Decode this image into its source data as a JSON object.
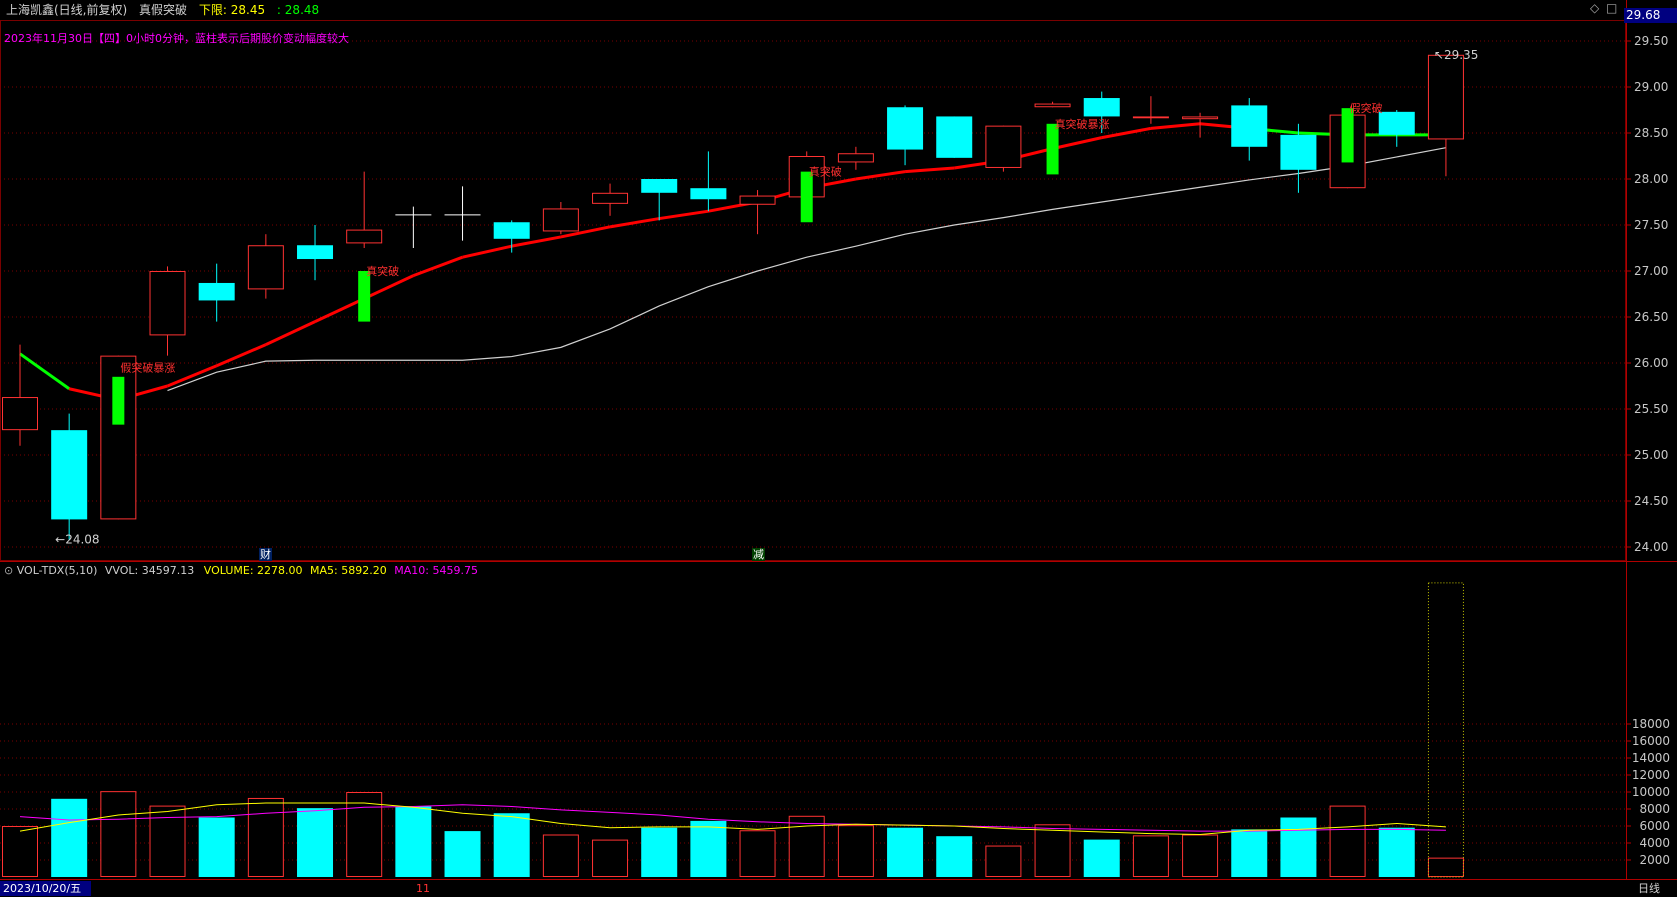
{
  "header": {
    "stock_name": "上海凯鑫(日线,前复权)",
    "indicator_name": "真假突破",
    "lower_limit_label": "下限:",
    "lower_limit_value": "28.45",
    "sep_label": ":",
    "sep_value": "28.48"
  },
  "info_line": "2023年11月30日【四】0小时0分钟，蓝柱表示后期股价变动幅度较大",
  "top_right": {
    "price_box": "29.68",
    "diamond": "◇",
    "square": "□"
  },
  "volume_header": {
    "name": "VOL-TDX(5,10)",
    "vvol_label": "VVOL: 34597.13",
    "volume_label": "VOLUME: 2278.00",
    "ma5_label": "MA5: 5892.20",
    "ma10_label": "MA10: 5459.75"
  },
  "bottom": {
    "date_box": "2023/10/20/五",
    "month_mark": "11",
    "period": "日线"
  },
  "event_marks": {
    "cai": "财",
    "jian": "减"
  },
  "colors": {
    "up": "#ff3232",
    "down": "#00ffff",
    "flat": "#ffffff",
    "ma_red": "#ff0000",
    "ma_green": "#00ff00",
    "ma_white": "#d0d0d0",
    "vol_ma5": "#ffff00",
    "vol_ma10": "#ff00ff",
    "grid": "#7a0000",
    "signal_text": "#ff3030",
    "header_yellow": "#ffff00",
    "header_green": "#00ff00",
    "header_magenta": "#ff00ff"
  },
  "chart_data": {
    "type": "candlestick",
    "price_axis": {
      "min": 24.0,
      "max": 29.5,
      "ticks": [
        24.0,
        24.5,
        25.0,
        25.5,
        26.0,
        26.5,
        27.0,
        27.5,
        28.0,
        28.5,
        29.0,
        29.5
      ]
    },
    "volume_axis": {
      "min": 0,
      "max": 34597.13,
      "ticks": [
        2000,
        4000,
        6000,
        8000,
        10000,
        12000,
        14000,
        16000,
        18000
      ]
    },
    "candles": [
      {
        "o": 25.27,
        "c": 25.63,
        "h": 26.2,
        "l": 25.1,
        "v": 6000
      },
      {
        "o": 25.27,
        "c": 24.3,
        "h": 25.45,
        "l": 24.08,
        "v": 9200
      },
      {
        "o": 24.3,
        "c": 26.08,
        "h": 26.08,
        "l": 24.3,
        "v": 10100
      },
      {
        "o": 26.3,
        "c": 27.0,
        "h": 27.05,
        "l": 26.08,
        "v": 8400
      },
      {
        "o": 26.87,
        "c": 26.68,
        "h": 27.08,
        "l": 26.45,
        "v": 7000
      },
      {
        "o": 26.8,
        "c": 27.28,
        "h": 27.4,
        "l": 26.7,
        "v": 9300
      },
      {
        "o": 27.28,
        "c": 27.13,
        "h": 27.5,
        "l": 26.9,
        "v": 8100
      },
      {
        "o": 27.3,
        "c": 27.45,
        "h": 28.08,
        "l": 27.25,
        "v": 10000
      },
      {
        "o": 27.61,
        "c": 27.61,
        "h": 27.7,
        "l": 27.25,
        "v": 8300
      },
      {
        "o": 27.61,
        "c": 27.61,
        "h": 27.92,
        "l": 27.33,
        "v": 5400
      },
      {
        "o": 27.53,
        "c": 27.35,
        "h": 27.55,
        "l": 27.2,
        "v": 7500
      },
      {
        "o": 27.43,
        "c": 27.68,
        "h": 27.75,
        "l": 27.4,
        "v": 5000
      },
      {
        "o": 27.73,
        "c": 27.85,
        "h": 27.95,
        "l": 27.6,
        "v": 4400
      },
      {
        "o": 28.0,
        "c": 27.85,
        "h": 28.0,
        "l": 27.55,
        "v": 5800
      },
      {
        "o": 27.9,
        "c": 27.78,
        "h": 28.3,
        "l": 27.65,
        "v": 6600
      },
      {
        "o": 27.72,
        "c": 27.82,
        "h": 27.88,
        "l": 27.4,
        "v": 5500
      },
      {
        "o": 27.8,
        "c": 28.25,
        "h": 28.3,
        "l": 27.7,
        "v": 7200
      },
      {
        "o": 28.18,
        "c": 28.28,
        "h": 28.35,
        "l": 28.1,
        "v": 6100
      },
      {
        "o": 28.78,
        "c": 28.32,
        "h": 28.8,
        "l": 28.15,
        "v": 5800
      },
      {
        "o": 28.68,
        "c": 28.23,
        "h": 28.68,
        "l": 28.23,
        "v": 4800
      },
      {
        "o": 28.12,
        "c": 28.58,
        "h": 28.58,
        "l": 28.08,
        "v": 3700
      },
      {
        "o": 28.78,
        "c": 28.82,
        "h": 28.84,
        "l": 28.78,
        "v": 6200
      },
      {
        "o": 28.88,
        "c": 28.68,
        "h": 28.95,
        "l": 28.5,
        "v": 4400
      },
      {
        "o": 28.66,
        "c": 28.68,
        "h": 28.9,
        "l": 28.6,
        "v": 4900
      },
      {
        "o": 28.65,
        "c": 28.68,
        "h": 28.72,
        "l": 28.45,
        "v": 5000
      },
      {
        "o": 28.8,
        "c": 28.35,
        "h": 28.88,
        "l": 28.2,
        "v": 5600
      },
      {
        "o": 28.48,
        "c": 28.1,
        "h": 28.6,
        "l": 27.85,
        "v": 7000
      },
      {
        "o": 27.9,
        "c": 28.7,
        "h": 28.75,
        "l": 27.9,
        "v": 8400
      },
      {
        "o": 28.73,
        "c": 28.48,
        "h": 28.75,
        "l": 28.35,
        "v": 5800
      },
      {
        "o": 28.43,
        "c": 29.35,
        "h": 29.35,
        "l": 28.03,
        "v": 2278
      }
    ],
    "future_volume_box": 34597.13,
    "ma_white": [
      null,
      null,
      null,
      25.7,
      25.9,
      26.02,
      26.03,
      26.03,
      26.03,
      26.03,
      26.07,
      26.17,
      26.37,
      26.62,
      26.83,
      27.0,
      27.15,
      27.27,
      27.4,
      27.5,
      27.58,
      27.67,
      27.75,
      27.83,
      27.91,
      27.99,
      28.06,
      28.14,
      28.24,
      28.34
    ],
    "ma_signal": [
      26.1,
      25.72,
      25.6,
      25.75,
      25.97,
      26.2,
      26.45,
      26.7,
      26.95,
      27.15,
      27.27,
      27.37,
      27.48,
      27.57,
      27.65,
      27.75,
      27.9,
      28.0,
      28.08,
      28.12,
      28.2,
      28.33,
      28.45,
      28.55,
      28.6,
      28.55,
      28.5,
      28.48,
      28.48,
      28.48
    ],
    "ma_signal_colors": [
      "g",
      "g",
      "r",
      "r",
      "r",
      "r",
      "r",
      "r",
      "r",
      "r",
      "r",
      "r",
      "r",
      "r",
      "r",
      "r",
      "r",
      "r",
      "r",
      "r",
      "r",
      "r",
      "r",
      "r",
      "r",
      "x",
      "g",
      "g",
      "g",
      "g"
    ],
    "vol_ma5": [
      5400,
      6400,
      7300,
      7700,
      8500,
      8700,
      8700,
      8700,
      8200,
      7500,
      7100,
      6300,
      5800,
      5900,
      5900,
      5600,
      6000,
      6200,
      6100,
      6000,
      5700,
      5500,
      5300,
      5100,
      5000,
      5500,
      5600,
      5900,
      6300,
      5900
    ],
    "vol_ma10": [
      7100,
      6700,
      6800,
      7000,
      7100,
      7500,
      7800,
      8200,
      8300,
      8500,
      8300,
      7900,
      7600,
      7300,
      6800,
      6500,
      6300,
      6200,
      6100,
      6000,
      5900,
      5700,
      5600,
      5500,
      5400,
      5400,
      5500,
      5600,
      5600,
      5500
    ],
    "signals": [
      {
        "index": 2,
        "text": "假突破暴涨",
        "color": "red_box"
      },
      {
        "index": 7,
        "text": "真突破",
        "color": "green_bar",
        "bar_top": 27.0,
        "bar_bottom": 26.45
      },
      {
        "index": 16,
        "text": "真突破",
        "color": "green_bar",
        "bar_top": 28.08,
        "bar_bottom": 27.53
      },
      {
        "index": 21,
        "text": "真突破暴涨",
        "color": "green_bar",
        "bar_top": 28.6,
        "bar_bottom": 28.05
      },
      {
        "index": 27,
        "text": "假突破",
        "color": "green_bar",
        "bar_top": 28.77,
        "bar_bottom": 28.18
      }
    ],
    "green_signal_bar0": {
      "index": 2,
      "top": 25.85,
      "bottom": 25.33
    },
    "price_labels": {
      "low_label": "24.08",
      "high_label": "29.35"
    }
  }
}
